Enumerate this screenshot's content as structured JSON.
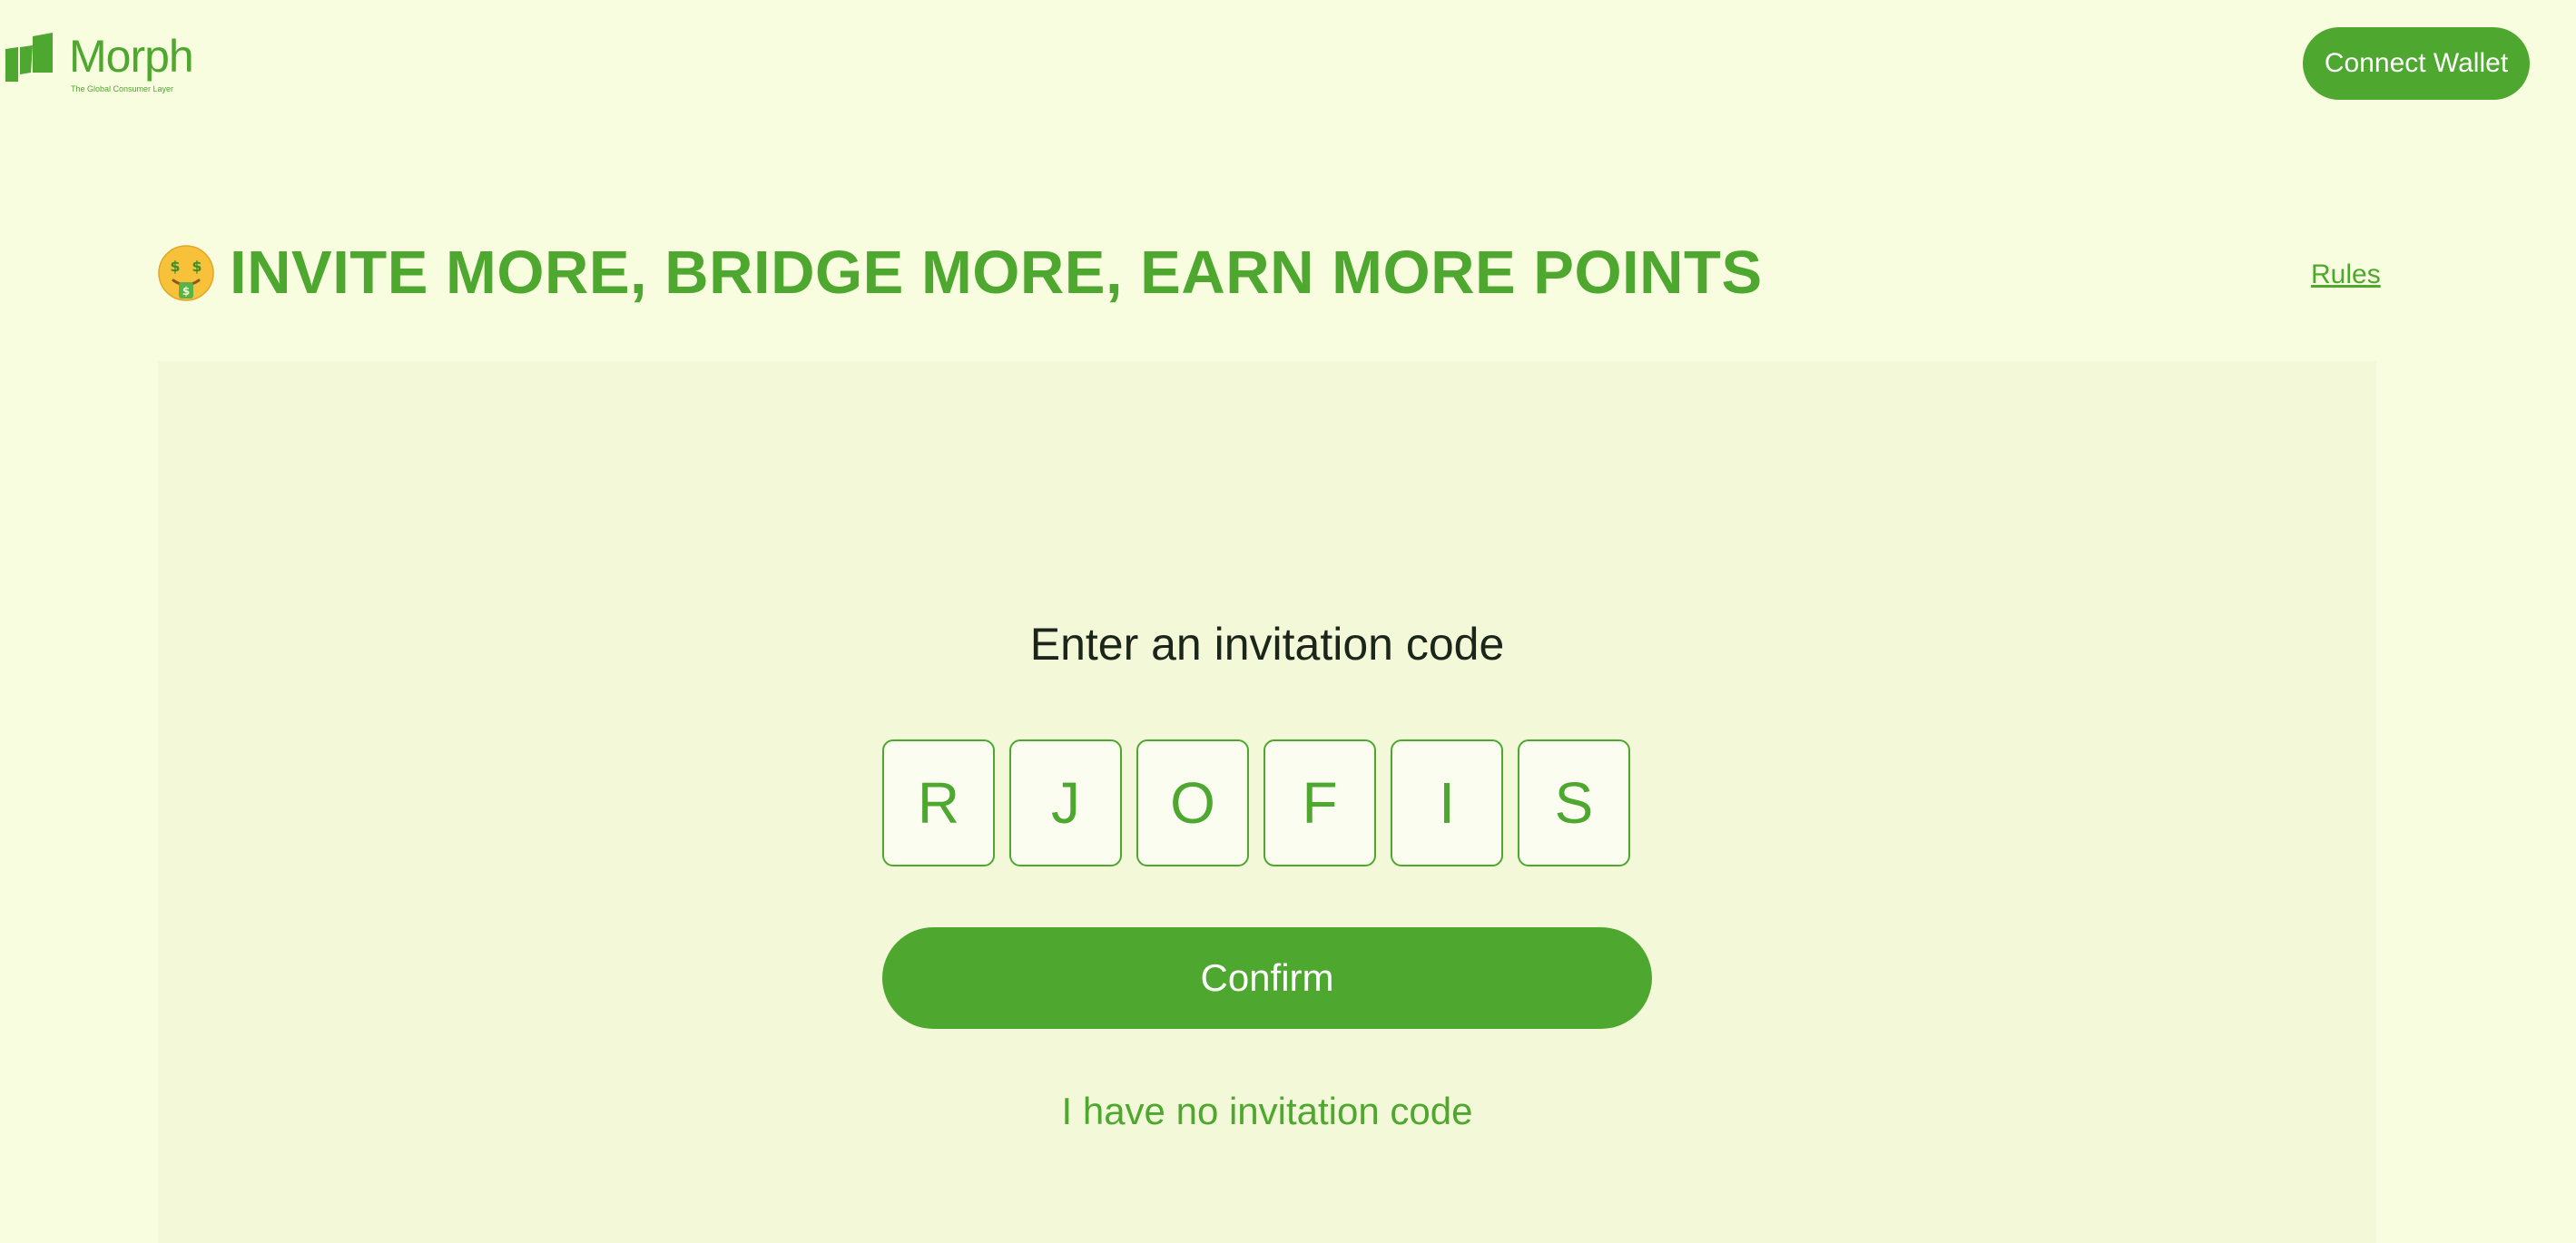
{
  "header": {
    "logo": {
      "name": "Morph",
      "tagline": "The Global Consumer Layer",
      "icon": "morph-logo-icon"
    },
    "connect_wallet_label": "Connect Wallet"
  },
  "title_row": {
    "emoji_icon": "money-mouth-face-icon",
    "title": "INVITE MORE, BRIDGE MORE, EARN MORE POINTS",
    "rules_label": "Rules"
  },
  "invite_panel": {
    "heading": "Enter an invitation code",
    "code_chars": [
      "R",
      "J",
      "O",
      "F",
      "I",
      "S"
    ],
    "confirm_label": "Confirm",
    "no_code_label": "I have no invitation code"
  },
  "colors": {
    "page_background": "#f8fde0",
    "panel_background": "#f3f9d8",
    "brand_green": "#4ea72e",
    "heading_text": "#1c2519"
  }
}
